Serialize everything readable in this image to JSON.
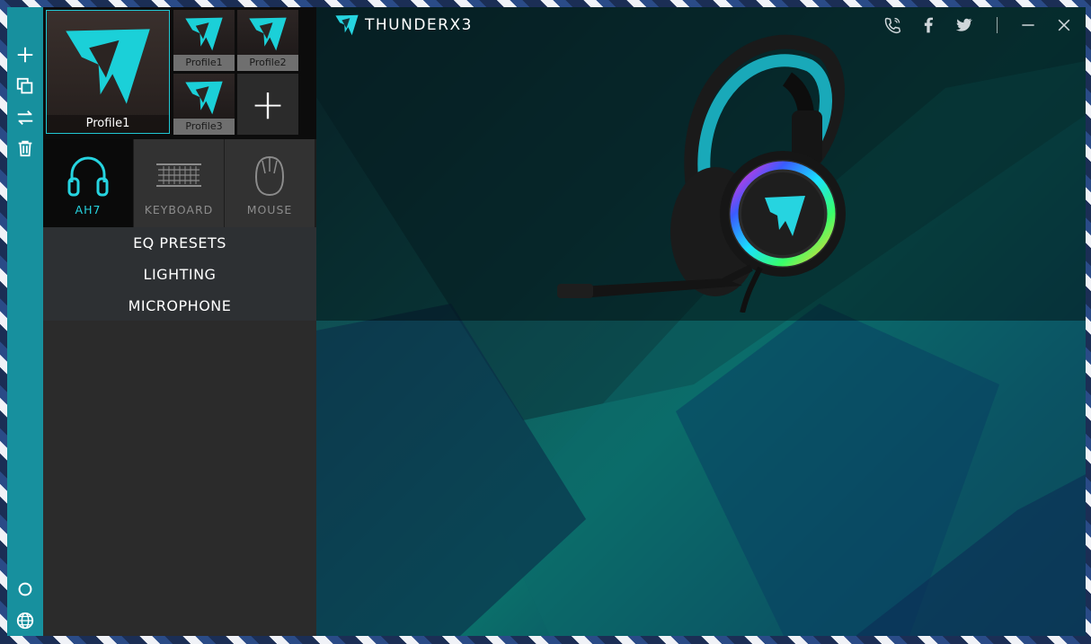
{
  "app": {
    "brand": "THUNDERX3"
  },
  "profiles": {
    "main": "Profile1",
    "tiles": [
      "Profile1",
      "Profile2",
      "Profile3"
    ],
    "add_label": "+"
  },
  "devices": [
    {
      "label": "AH7",
      "active": true
    },
    {
      "label": "KEYBOARD",
      "active": false
    },
    {
      "label": "MOUSE",
      "active": false
    }
  ],
  "menu": [
    "EQ PRESETS",
    "LIGHTING",
    "MICROPHONE"
  ],
  "rail": [
    "add-icon",
    "copy-icon",
    "swap-icon",
    "trash-icon",
    "settings-icon",
    "globe-icon"
  ],
  "colors": {
    "accent": "#26d4e0",
    "rail": "#17909e"
  }
}
